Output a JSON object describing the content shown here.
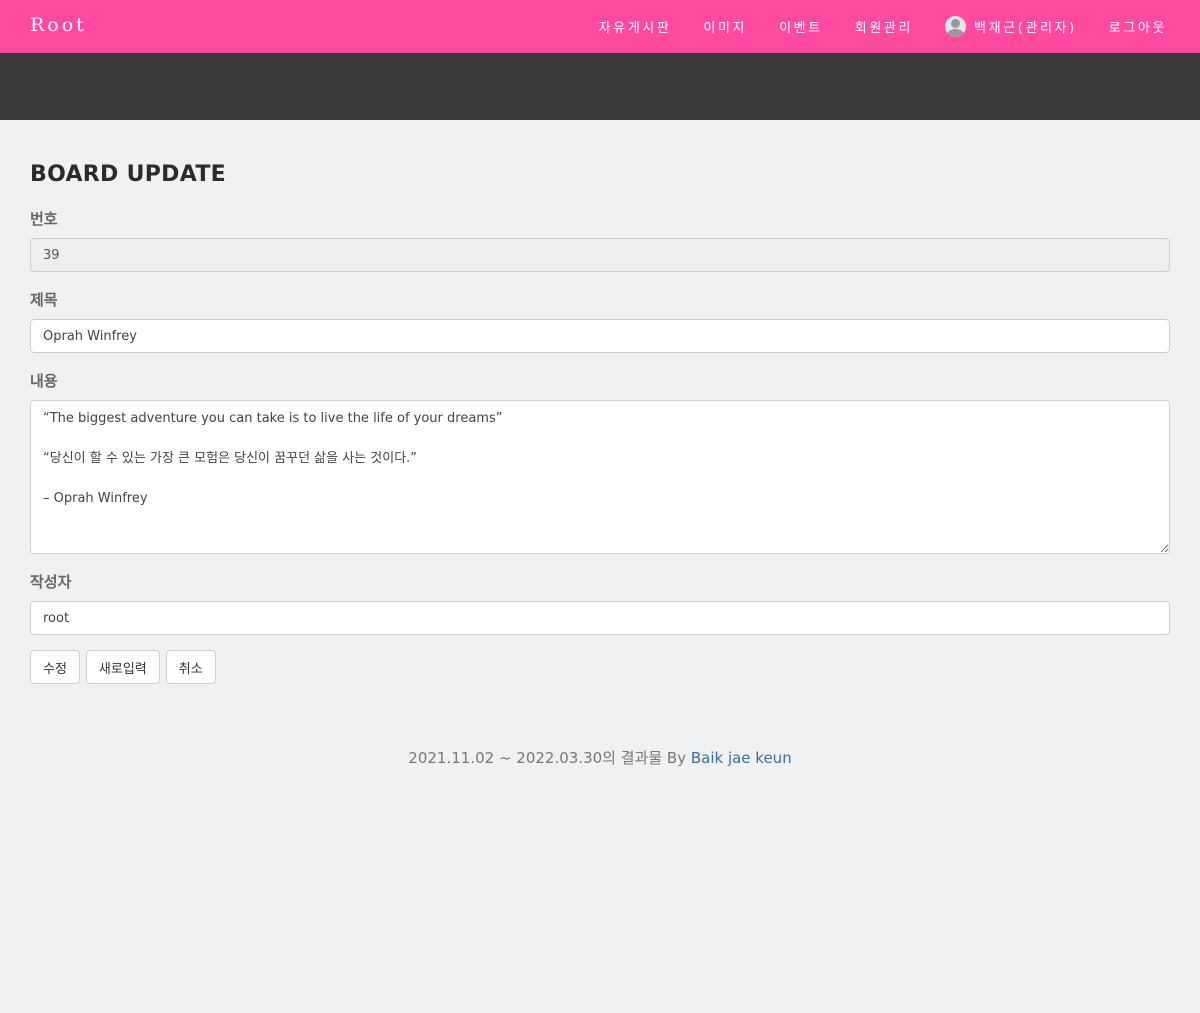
{
  "navbar": {
    "brand": "Root",
    "links": [
      {
        "label": "자유게시판"
      },
      {
        "label": "이미지"
      },
      {
        "label": "이벤트"
      },
      {
        "label": "회원관리"
      },
      {
        "label": "백재근(관리자)",
        "icon": "user-avatar-icon"
      },
      {
        "label": "로그아웃"
      }
    ],
    "bg_color": "#ff4aa0"
  },
  "hero": {
    "bg_color": "#393939"
  },
  "form": {
    "title": "BOARD UPDATE",
    "number_label": "번호",
    "number_value": "39",
    "subject_label": "제목",
    "subject_value": "Oprah Winfrey",
    "content_label": "내용",
    "content_value": "“The biggest adventure you can take is to live the life of your dreams”\n\n“당신이 할 수 있는 가장 큰 모험은 당신이 꿈꾸던 삶을 사는 것이다.”\n\n– Oprah Winfrey",
    "writer_label": "작성자",
    "writer_value": "root",
    "buttons": {
      "update": "수정",
      "reset": "새로입력",
      "cancel": "취소"
    }
  },
  "footer": {
    "text": "2021.11.02 ~ 2022.03.30의 결과물 By ",
    "author_link": "Baik jae keun"
  }
}
